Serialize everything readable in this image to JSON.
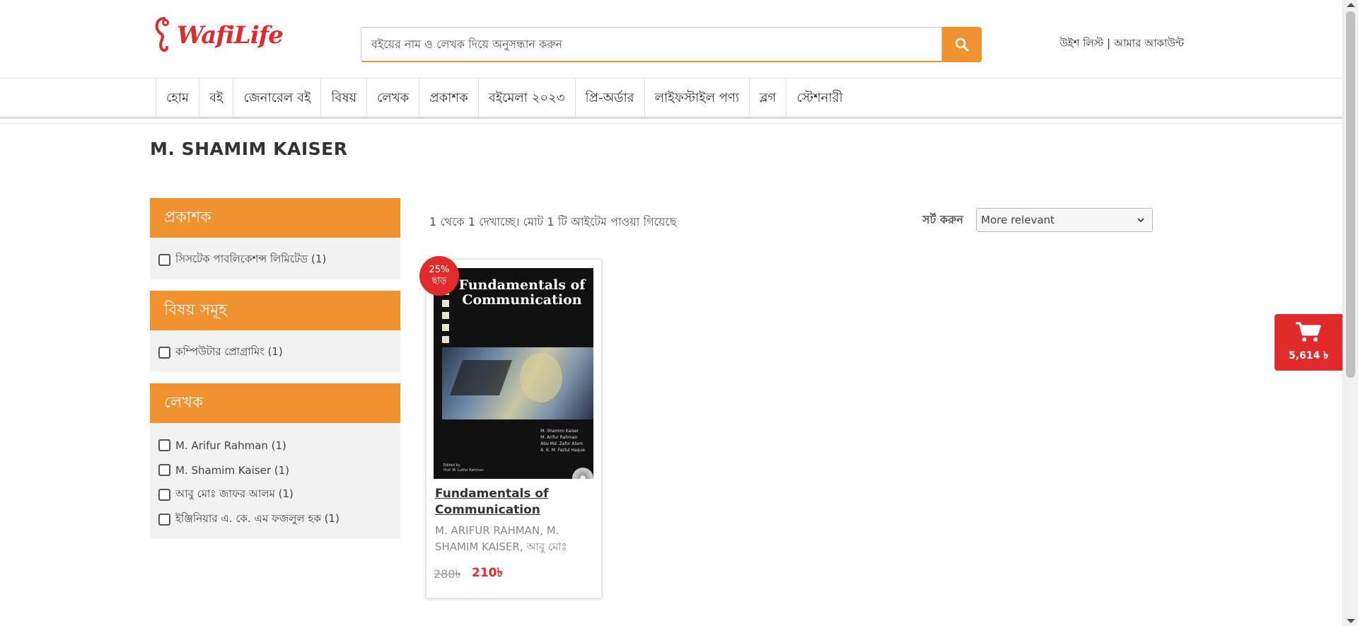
{
  "header": {
    "logo_text": "WafiLife",
    "search": {
      "value": "",
      "placeholder": "বইয়ের নাম ও লেখক দিয়ে অনুসন্ধান করুন"
    },
    "search_icon": "search-icon",
    "top_links": {
      "wishlist": "উইশ লিস্ট",
      "separator": "|",
      "account": "আমার আকাউন্ট"
    },
    "colors": {
      "accent": "#f0922f",
      "brand_red": "#e12b2b"
    }
  },
  "nav": {
    "items": [
      "হোম",
      "বই",
      "জেনারেল বই",
      "বিষয়",
      "লেখক",
      "প্রকাশক",
      "বইমেলা ২০২৩",
      "প্রি-অর্ডার",
      "লাইফস্টাইল পণ্য",
      "ব্লগ",
      "স্টেশনারী"
    ]
  },
  "page": {
    "title": "M. SHAMIM KAISER"
  },
  "filters": {
    "publisher": {
      "heading": "প্রকাশক",
      "options": [
        "সিসটেক পাবলিকেশন্স লিমিটেড (1)"
      ]
    },
    "subjects": {
      "heading": "বিষয় সমূহ",
      "options": [
        "কম্পিউটার প্রোগ্রামিং (1)"
      ]
    },
    "authors": {
      "heading": "লেখক",
      "options": [
        "M. Arifur Rahman (1)",
        "M. Shamim Kaiser (1)",
        "আবু মোঃ জাফর আলম (1)",
        "ইঞ্জিনিয়ার এ. কে. এম ফজলুল হক (1)"
      ]
    }
  },
  "results": {
    "info": "1 থেকে 1 দেখাচ্ছে। মোট 1 টি আইটেম পাওয়া গিয়েছে",
    "sort_label": "সর্ট করুন",
    "sort_value": "More relevant"
  },
  "product": {
    "badge_percent": "25%",
    "badge_text": "ছাড়",
    "cover_title": "Fundamentals of Communication",
    "cover_authors": [
      "M. Shamim Kaiser",
      "M. Arifur Rahman",
      "Abu Md. Zafor Alam",
      "A. K. M. Fazlul Haque"
    ],
    "cover_editor": [
      "Edited by",
      "Prof. M. Lutfar Rahman"
    ],
    "title": "Fundamentals of Communication",
    "authors": "M. ARIFUR RAHMAN, M. SHAMIM KAISER, আবু মোঃ",
    "old_price": "280৳",
    "new_price": "210৳"
  },
  "cart": {
    "icon": "cart-icon",
    "total": "5,614 ৳"
  }
}
